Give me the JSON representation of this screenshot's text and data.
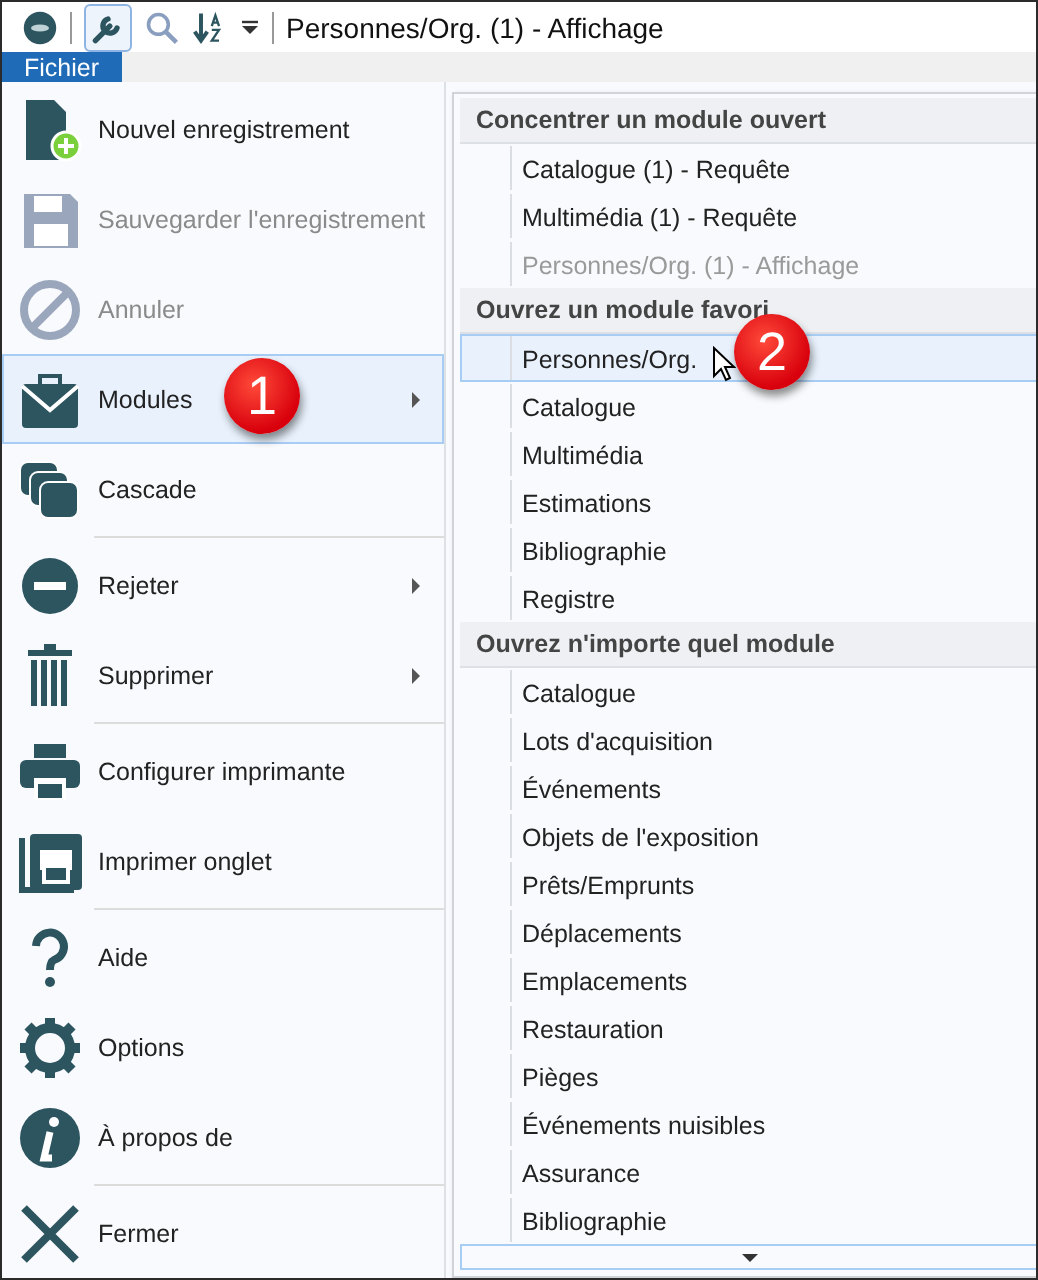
{
  "window": {
    "title": "Personnes/Org. (1) - Affichage"
  },
  "menu_bar": [
    {
      "label": "Fichier",
      "selected": true
    }
  ],
  "file_menu": {
    "groups": [
      [
        {
          "label": "Nouvel enregistrement",
          "disabled": false,
          "highlighted": false,
          "submenu": false
        },
        {
          "label": "Sauvegarder l'enregistrement",
          "disabled": true,
          "highlighted": false,
          "submenu": false
        },
        {
          "label": "Annuler",
          "disabled": true,
          "highlighted": false,
          "submenu": false
        },
        {
          "label": "Modules",
          "disabled": false,
          "highlighted": true,
          "submenu": true
        },
        {
          "label": "Cascade",
          "disabled": false,
          "highlighted": false,
          "submenu": false
        }
      ],
      [
        {
          "label": "Rejeter",
          "disabled": false,
          "highlighted": false,
          "submenu": true
        },
        {
          "label": "Supprimer",
          "disabled": false,
          "highlighted": false,
          "submenu": true
        }
      ],
      [
        {
          "label": "Configurer imprimante",
          "disabled": false,
          "highlighted": false,
          "submenu": false
        },
        {
          "label": "Imprimer onglet",
          "disabled": false,
          "highlighted": false,
          "submenu": false
        }
      ],
      [
        {
          "label": "Aide",
          "disabled": false,
          "highlighted": false,
          "submenu": false
        },
        {
          "label": "Options",
          "disabled": false,
          "highlighted": false,
          "submenu": false
        },
        {
          "label": "À propos de",
          "disabled": false,
          "highlighted": false,
          "submenu": false
        }
      ],
      [
        {
          "label": "Fermer",
          "disabled": false,
          "highlighted": false,
          "submenu": false
        }
      ]
    ]
  },
  "modules_submenu": {
    "sections": [
      {
        "header": "Concentrer un module ouvert",
        "items": [
          {
            "label": "Catalogue (1) - Requête",
            "disabled": false,
            "highlighted": false
          },
          {
            "label": "Multimédia (1) - Requête",
            "disabled": false,
            "highlighted": false
          },
          {
            "label": "Personnes/Org. (1) - Affichage",
            "disabled": true,
            "highlighted": false
          }
        ]
      },
      {
        "header": "Ouvrez un module favori",
        "items": [
          {
            "label": "Personnes/Org.",
            "disabled": false,
            "highlighted": true
          },
          {
            "label": "Catalogue",
            "disabled": false,
            "highlighted": false
          },
          {
            "label": "Multimédia",
            "disabled": false,
            "highlighted": false
          },
          {
            "label": "Estimations",
            "disabled": false,
            "highlighted": false
          },
          {
            "label": "Bibliographie",
            "disabled": false,
            "highlighted": false
          },
          {
            "label": "Registre",
            "disabled": false,
            "highlighted": false
          }
        ]
      },
      {
        "header": "Ouvrez n'importe quel module",
        "items": [
          {
            "label": "Catalogue",
            "disabled": false,
            "highlighted": false
          },
          {
            "label": "Lots d'acquisition",
            "disabled": false,
            "highlighted": false
          },
          {
            "label": "Événements",
            "disabled": false,
            "highlighted": false
          },
          {
            "label": "Objets de l'exposition",
            "disabled": false,
            "highlighted": false
          },
          {
            "label": "Prêts/Emprunts",
            "disabled": false,
            "highlighted": false
          },
          {
            "label": "Déplacements",
            "disabled": false,
            "highlighted": false
          },
          {
            "label": "Emplacements",
            "disabled": false,
            "highlighted": false
          },
          {
            "label": "Restauration",
            "disabled": false,
            "highlighted": false
          },
          {
            "label": "Pièges",
            "disabled": false,
            "highlighted": false
          },
          {
            "label": "Événements nuisibles",
            "disabled": false,
            "highlighted": false
          },
          {
            "label": "Assurance",
            "disabled": false,
            "highlighted": false
          },
          {
            "label": "Bibliographie",
            "disabled": false,
            "highlighted": false
          }
        ]
      }
    ]
  },
  "callouts": [
    "1",
    "2"
  ]
}
